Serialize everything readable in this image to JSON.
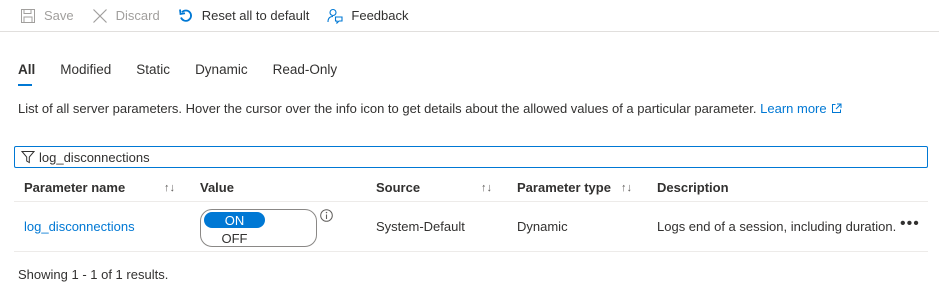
{
  "toolbar": {
    "save_label": "Save",
    "discard_label": "Discard",
    "reset_label": "Reset all to default",
    "feedback_label": "Feedback"
  },
  "tabs": [
    {
      "label": "All",
      "active": true
    },
    {
      "label": "Modified"
    },
    {
      "label": "Static"
    },
    {
      "label": "Dynamic"
    },
    {
      "label": "Read-Only"
    }
  ],
  "description": {
    "text": "List of all server parameters. Hover the cursor over the info icon to get details about the allowed values of a particular parameter.",
    "link": "Learn more"
  },
  "filter": {
    "value": "log_disconnections"
  },
  "table": {
    "headers": {
      "name": "Parameter name",
      "value": "Value",
      "source": "Source",
      "type": "Parameter type",
      "description": "Description"
    },
    "rows": [
      {
        "name": "log_disconnections",
        "toggle_on": "ON",
        "toggle_off": "OFF",
        "source": "System-Default",
        "type": "Dynamic",
        "description": "Logs end of a session, including duration."
      }
    ]
  },
  "footer": {
    "text": "Showing 1 - 1 of 1 results."
  },
  "colors": {
    "accent": "#0078d4",
    "disabled": "#a19f9d"
  }
}
